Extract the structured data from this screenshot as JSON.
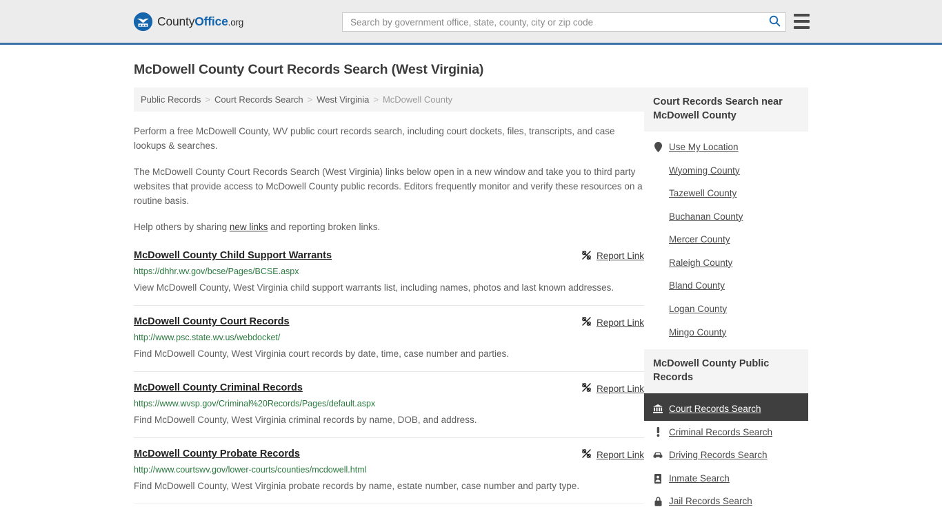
{
  "header": {
    "logo": {
      "part1": "County",
      "part2": "Office",
      "part3": ".org",
      "icon": "eagle-seal-icon"
    },
    "search": {
      "placeholder": "Search by government office, state, county, city or zip code",
      "value": "",
      "icon": "search-icon"
    },
    "menu_icon": "hamburger-menu-icon",
    "brand_blue": "#1565ad",
    "accent_border": "#3a72a8"
  },
  "page": {
    "title": "McDowell County Court Records Search (West Virginia)"
  },
  "breadcrumb": {
    "separator": ">",
    "items": [
      {
        "label": "Public Records",
        "current": false
      },
      {
        "label": "Court Records Search",
        "current": false
      },
      {
        "label": "West Virginia",
        "current": false
      },
      {
        "label": "McDowell County",
        "current": true
      }
    ]
  },
  "intro": {
    "p1": "Perform a free McDowell County, WV public court records search, including court dockets, files, transcripts, and case lookups & searches.",
    "p2": "The McDowell County Court Records Search (West Virginia) links below open in a new window and take you to third party websites that provide access to McDowell County public records. Editors frequently monitor and verify these resources on a routine basis.",
    "p3_before": "Help others by sharing ",
    "p3_link": "new links",
    "p3_after": " and reporting broken links."
  },
  "results": {
    "report_label": "Report Link",
    "report_icon": "broken-link-icon",
    "items": [
      {
        "title": "McDowell County Child Support Warrants",
        "url": "https://dhhr.wv.gov/bcse/Pages/BCSE.aspx",
        "description": "View McDowell County, West Virginia child support warrants list, including names, photos and last known addresses."
      },
      {
        "title": "McDowell County Court Records",
        "url": "http://www.psc.state.wv.us/webdocket/",
        "description": "Find McDowell County, West Virginia court records by date, time, case number and parties."
      },
      {
        "title": "McDowell County Criminal Records",
        "url": "https://www.wvsp.gov/Criminal%20Records/Pages/default.aspx",
        "description": "Find McDowell County, West Virginia criminal records by name, DOB, and address."
      },
      {
        "title": "McDowell County Probate Records",
        "url": "http://www.courtswv.gov/lower-courts/counties/mcdowell.html",
        "description": "Find McDowell County, West Virginia probate records by name, estate number, case number and party type."
      }
    ]
  },
  "sidebar": {
    "nearby": {
      "heading": "Court Records Search near McDowell County",
      "items": [
        {
          "label": "Use My Location",
          "icon": "map-pin-icon"
        },
        {
          "label": "Wyoming County",
          "icon": ""
        },
        {
          "label": "Tazewell County",
          "icon": ""
        },
        {
          "label": "Buchanan County",
          "icon": ""
        },
        {
          "label": "Mercer County",
          "icon": ""
        },
        {
          "label": "Raleigh County",
          "icon": ""
        },
        {
          "label": "Bland County",
          "icon": ""
        },
        {
          "label": "Logan County",
          "icon": ""
        },
        {
          "label": "Mingo County",
          "icon": ""
        }
      ]
    },
    "public_records": {
      "heading": "McDowell County Public Records",
      "items": [
        {
          "label": "Court Records Search",
          "icon": "courthouse-icon",
          "active": true
        },
        {
          "label": "Criminal Records Search",
          "icon": "exclamation-icon",
          "active": false
        },
        {
          "label": "Driving Records Search",
          "icon": "car-icon",
          "active": false
        },
        {
          "label": "Inmate Search",
          "icon": "id-card-icon",
          "active": false
        },
        {
          "label": "Jail Records Search",
          "icon": "lock-icon",
          "active": false
        }
      ]
    }
  }
}
